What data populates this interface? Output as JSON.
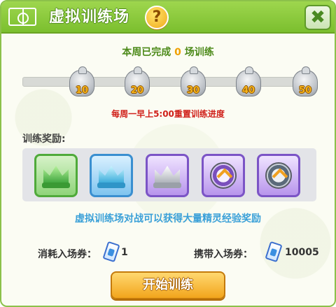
{
  "header": {
    "title": "虚拟训练场",
    "help_label": "?",
    "close_label": "✖",
    "court_icon": "court-icon"
  },
  "weekly": {
    "prefix": "本周已完成",
    "count": "0",
    "suffix": "场训练"
  },
  "progress": {
    "completed": 0,
    "milestones": [
      "10",
      "20",
      "30",
      "40",
      "50"
    ],
    "reset_note": "每周一早上5:00重置训练进度"
  },
  "rewards": {
    "label": "训练奖励:",
    "items": [
      {
        "icon": "green-crown-icon",
        "color": "#4faa3a"
      },
      {
        "icon": "blue-crown-icon",
        "color": "#3a8fd0"
      },
      {
        "icon": "silver-crown-icon",
        "color": "#7b54c6"
      },
      {
        "icon": "purple-medal-icon",
        "color": "#7b54c6"
      },
      {
        "icon": "silver-medal-icon",
        "color": "#7b54c6"
      }
    ],
    "description": "虚拟训练场对战可以获得大量精灵经验奖励"
  },
  "tickets": {
    "consume_label": "消耗入场券：",
    "consume_value": "1",
    "carry_label": "携带入场券：",
    "carry_value": "10005"
  },
  "start_button": {
    "label": "开始训练"
  },
  "colors": {
    "header_green": "#8cc14a",
    "count_orange": "#f0a000",
    "reset_red": "#d0201a",
    "desc_blue": "#3aa0d8",
    "button_orange": "#f2a51c"
  }
}
